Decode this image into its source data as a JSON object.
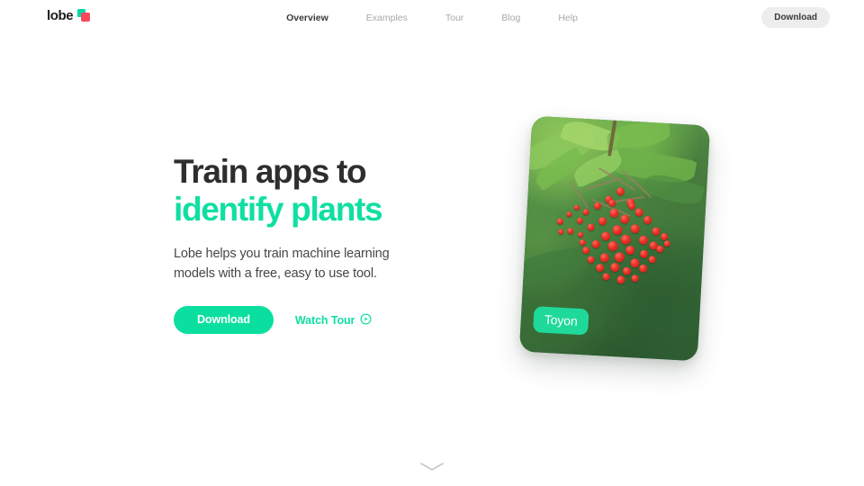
{
  "header": {
    "brand": {
      "wordmark": "lobe",
      "mark_icon": "lobe-squares-icon",
      "mark_colors": {
        "teal": "#00d9a3",
        "red": "#f8485e"
      }
    },
    "nav": [
      {
        "label": "Overview",
        "active": true
      },
      {
        "label": "Examples",
        "active": false
      },
      {
        "label": "Tour",
        "active": false
      },
      {
        "label": "Blog",
        "active": false
      },
      {
        "label": "Help",
        "active": false
      }
    ],
    "cta_label": "Download"
  },
  "hero": {
    "title_line1": "Train apps to",
    "title_line2": "identify plants",
    "subtitle": "Lobe helps you train machine learning models with a free, easy to use tool.",
    "primary_button": "Download",
    "secondary_button": "Watch Tour",
    "secondary_icon": "play-circle-icon",
    "card": {
      "label": "Toyon",
      "image_alt": "Cluster of red toyon berries on green foliage"
    }
  },
  "scroll_cue": {
    "icon": "chevron-down-icon"
  },
  "colors": {
    "accent_green": "#0fdfa2",
    "button_green": "#0bdf9f",
    "label_green": "#1fd99b",
    "title_dark": "#2e2e30",
    "nav_inactive": "#a8a8ad",
    "nav_active": "#3a3a3c",
    "header_button_bg": "#ededee",
    "page_background": "#ffffff"
  }
}
